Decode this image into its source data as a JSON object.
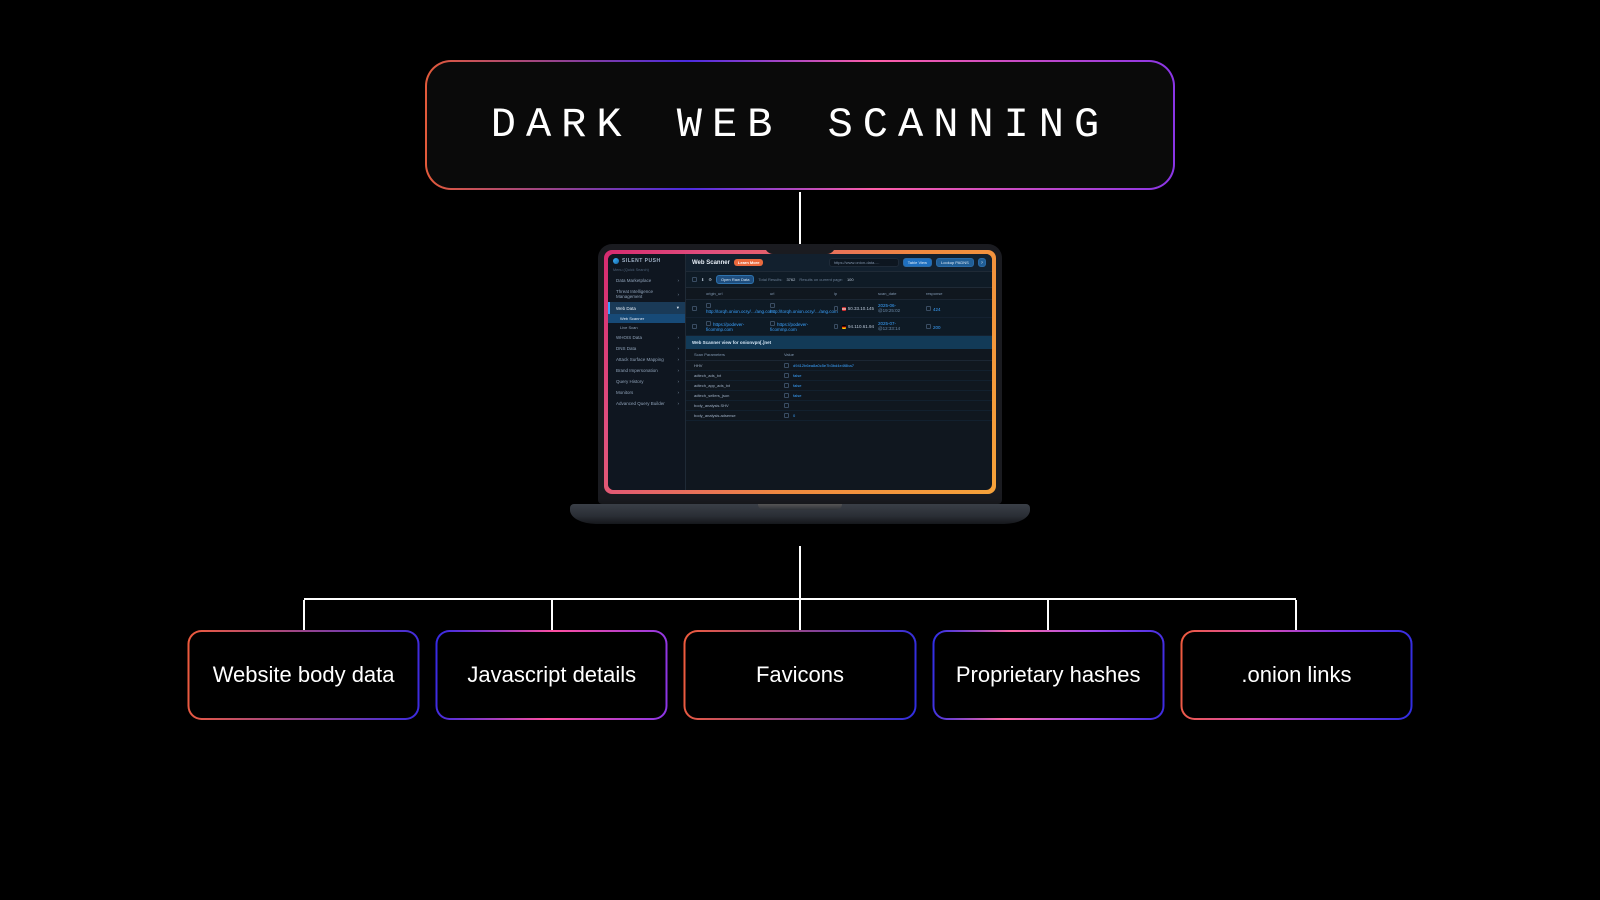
{
  "title": "DARK WEB SCANNING",
  "features": [
    "Website body data",
    "Javascript details",
    "Favicons",
    "Proprietary hashes",
    ".onion links"
  ],
  "laptop": {
    "brand": "SILENT PUSH",
    "page_title": "Web Scanner",
    "learn_more": "Learn More",
    "url_field": "https://www.onion-data-…",
    "btn_table": "Table View",
    "btn_lookup": "Lookup PADNS",
    "open_raw": "Open Raw Data",
    "total_results_label": "Total Results:",
    "total_results_value": "3762",
    "results_page_label": "Results on current page:",
    "results_page_value": "100",
    "nav_hint": "Menu (Quick Search)",
    "nav": [
      "Data Marketplace",
      "Threat Intelligence Management",
      "Web Data",
      "WHOIS Data",
      "DNS Data",
      "Attack Surface Mapping",
      "Brand Impersonation",
      "Query History",
      "Monitors",
      "Advanced Query Builder"
    ],
    "subnav": [
      "Web Scanner",
      "Live Scan"
    ],
    "columns": [
      "origin_url",
      "url",
      "ip",
      "scan_date",
      "response"
    ],
    "rows": [
      {
        "origin_url": "http://torqh.onion.ocry/…/ang.com",
        "url": "http://torqh.onion.ocry/…/ang.com",
        "ip": "50.33.10.145",
        "flag": "us",
        "date1": "2025-06-",
        "date2": "@19:25:02",
        "response": "424"
      },
      {
        "origin_url": "https://podever-ficommp.com",
        "url": "https://podever-ficommp.com",
        "ip": "94.110.61.94",
        "flag": "de",
        "date1": "2025-07-",
        "date2": "@12:33:14",
        "response": "200"
      }
    ],
    "detail_title": "Web Scanner view for onionvpn[.]net",
    "param_header_key": "Scan Parameters",
    "param_header_val": "Value",
    "params": [
      {
        "k": "HHV",
        "v": "d9412b6ea8a0c5e7b3bd4e4f8ba7"
      },
      {
        "k": "adtech_ads_txt",
        "v": "false"
      },
      {
        "k": "adtech_app_ads_txt",
        "v": "false"
      },
      {
        "k": "adtech_sellers_json",
        "v": "false"
      },
      {
        "k": "body_analysis.SHV",
        "v": ""
      },
      {
        "k": "body_analysis.adsense",
        "v": "0"
      }
    ]
  }
}
